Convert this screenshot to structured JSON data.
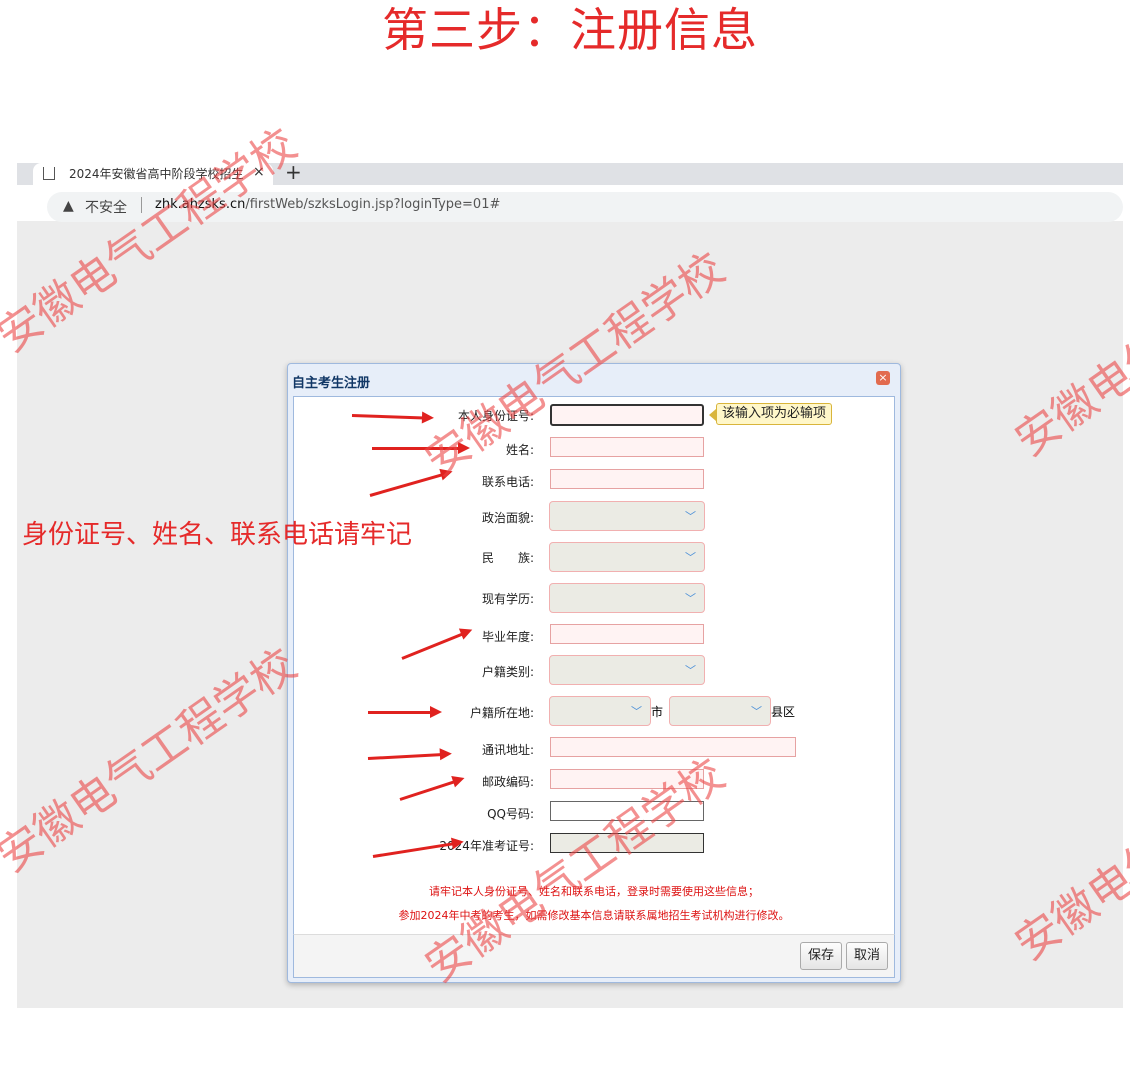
{
  "heading": "第三步：注册信息",
  "browser": {
    "tab_title": "2024年安徽省高中阶段学校招生",
    "tab_close": "×",
    "new_tab": "+",
    "insecure_label": "不安全",
    "url_host": "zhk.ahzsks.cn",
    "url_path": "/firstWeb/szksLogin.jsp?loginType=01#"
  },
  "dialog": {
    "title": "自主考生注册",
    "close": "×",
    "tooltip": "该输入项为必输项",
    "fields": {
      "id_number": "本人身份证号:",
      "name": "姓名:",
      "phone": "联系电话:",
      "political": "政治面貌:",
      "ethnicity": "民　　族:",
      "education": "现有学历:",
      "grad_year": "毕业年度:",
      "household_type": "户籍类别:",
      "household_location": "户籍所在地:",
      "city_suffix": "市",
      "county_suffix": "县区",
      "address": "通讯地址:",
      "postcode": "邮政编码:",
      "qq": "QQ号码:",
      "admission_ticket": "2024年准考证号:"
    },
    "note_line1": "请牢记本人身份证号、姓名和联系电话，登录时需要使用这些信息；",
    "note_line2": "参加2024年中考的考生，如需修改基本信息请联系属地招生考试机构进行修改。",
    "save_button": "保存",
    "cancel_button": "取消"
  },
  "annotation": "身份证号、姓名、联系电话请牢记",
  "watermarks": [
    "安徽电气工程学校"
  ],
  "colors": {
    "annotation_red": "#e52a2a",
    "required_field_border": "#e6a2a2",
    "dialog_border": "#9fb9de"
  }
}
